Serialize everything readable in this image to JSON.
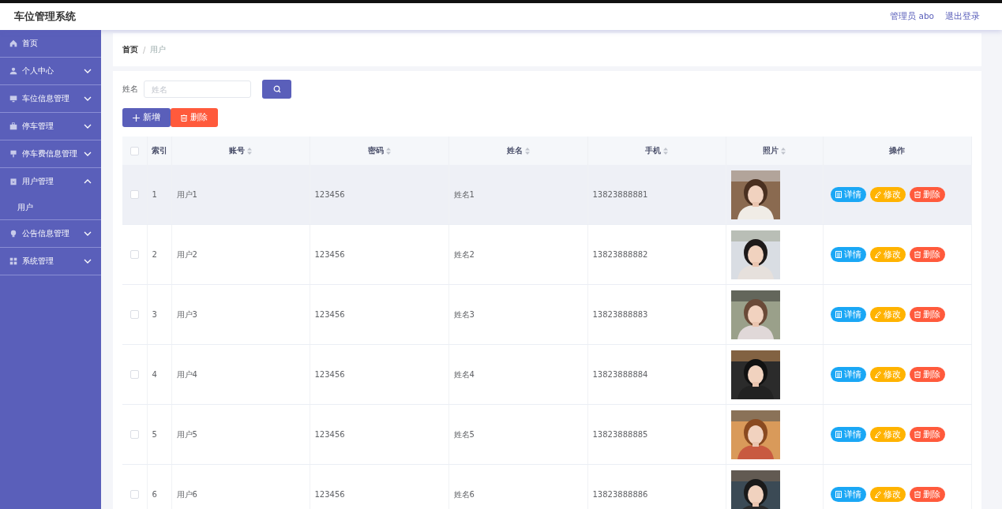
{
  "app": {
    "title": "车位管理系统",
    "user": "管理员 abo",
    "logout": "退出登录"
  },
  "sidebar": {
    "items": [
      {
        "label": "首页"
      },
      {
        "label": "个人中心",
        "expanded": false
      },
      {
        "label": "车位信息管理",
        "expanded": false
      },
      {
        "label": "停车管理",
        "expanded": false
      },
      {
        "label": "停车费信息管理",
        "expanded": false
      },
      {
        "label": "用户管理",
        "expanded": true,
        "children": [
          {
            "label": "用户"
          }
        ]
      },
      {
        "label": "公告信息管理",
        "expanded": false
      },
      {
        "label": "系统管理",
        "expanded": false
      }
    ]
  },
  "breadcrumb": {
    "items": [
      "首页",
      "用户"
    ],
    "separator": "/"
  },
  "search": {
    "label": "姓名",
    "placeholder": "姓名"
  },
  "actions": [
    {
      "label": "新增",
      "kind": "add"
    },
    {
      "label": "删除",
      "kind": "delete"
    }
  ],
  "table": {
    "all_checked": false,
    "columns": [
      {
        "label": "索引",
        "sortable": false
      },
      {
        "label": "账号",
        "sortable": true
      },
      {
        "label": "密码",
        "sortable": true
      },
      {
        "label": "姓名",
        "sortable": true
      },
      {
        "label": "手机",
        "sortable": true
      },
      {
        "label": "照片",
        "sortable": true
      },
      {
        "label": "操作",
        "sortable": false
      }
    ],
    "rows": [
      {
        "checked": false,
        "hovered": true,
        "cells": [
          "1",
          "用户1",
          "123456",
          "姓名1",
          "13823888881"
        ],
        "photo": {
          "kind": "picture"
        },
        "actions": [
          {
            "label": "详情",
            "kind": "detail"
          },
          {
            "label": "修改",
            "kind": "edit"
          },
          {
            "label": "删除",
            "kind": "delete"
          }
        ]
      },
      {
        "checked": false,
        "hovered": false,
        "cells": [
          "2",
          "用户2",
          "123456",
          "姓名2",
          "13823888882"
        ],
        "photo": {
          "kind": "picture"
        },
        "actions": [
          {
            "label": "详情",
            "kind": "detail"
          },
          {
            "label": "修改",
            "kind": "edit"
          },
          {
            "label": "删除",
            "kind": "delete"
          }
        ]
      },
      {
        "checked": false,
        "hovered": false,
        "cells": [
          "3",
          "用户3",
          "123456",
          "姓名3",
          "13823888883"
        ],
        "photo": {
          "kind": "picture"
        },
        "actions": [
          {
            "label": "详情",
            "kind": "detail"
          },
          {
            "label": "修改",
            "kind": "edit"
          },
          {
            "label": "删除",
            "kind": "delete"
          }
        ]
      },
      {
        "checked": false,
        "hovered": false,
        "cells": [
          "4",
          "用户4",
          "123456",
          "姓名4",
          "13823888884"
        ],
        "photo": {
          "kind": "picture"
        },
        "actions": [
          {
            "label": "详情",
            "kind": "detail"
          },
          {
            "label": "修改",
            "kind": "edit"
          },
          {
            "label": "删除",
            "kind": "delete"
          }
        ]
      },
      {
        "checked": false,
        "hovered": false,
        "cells": [
          "5",
          "用户5",
          "123456",
          "姓名5",
          "13823888885"
        ],
        "photo": {
          "kind": "picture"
        },
        "actions": [
          {
            "label": "详情",
            "kind": "detail"
          },
          {
            "label": "修改",
            "kind": "edit"
          },
          {
            "label": "删除",
            "kind": "delete"
          }
        ]
      },
      {
        "checked": false,
        "hovered": false,
        "cells": [
          "6",
          "用户6",
          "123456",
          "姓名6",
          "13823888886"
        ],
        "photo": {
          "kind": "picture"
        },
        "actions": [
          {
            "label": "详情",
            "kind": "detail"
          },
          {
            "label": "修改",
            "kind": "edit"
          },
          {
            "label": "删除",
            "kind": "delete"
          }
        ]
      }
    ]
  }
}
